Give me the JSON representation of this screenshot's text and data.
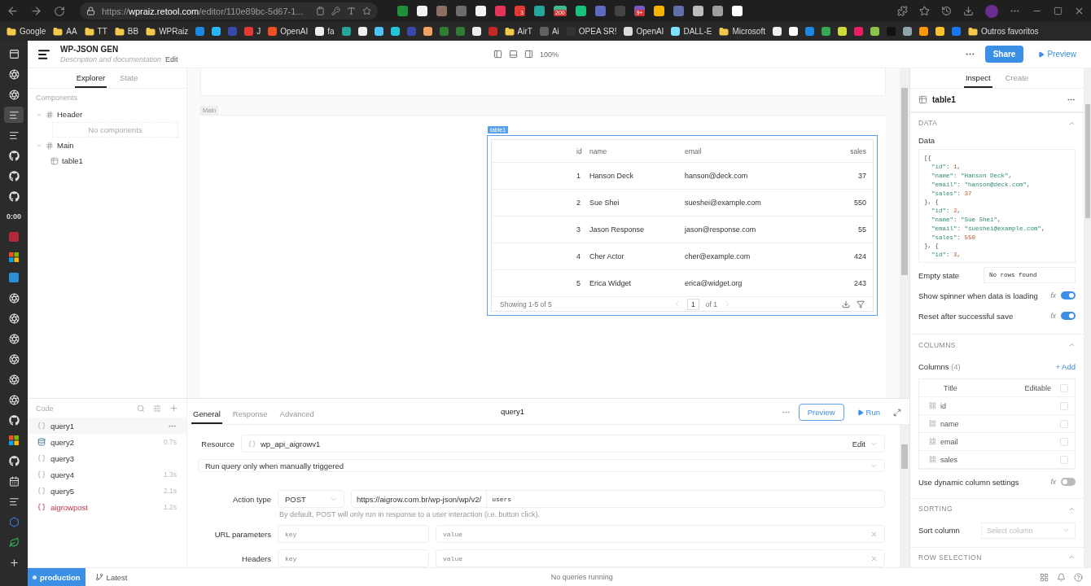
{
  "browser": {
    "url": "https://**wpraiz.retool.com**/editor/110e89bc-5d67-1...",
    "extensions": [
      {
        "color": "#1f8f3a"
      },
      {
        "color": "#f2f2f2"
      },
      {
        "color": "#8d6e63"
      },
      {
        "color": "#6d6d6d"
      },
      {
        "color": "#f2f2f2"
      },
      {
        "color": "#e8345a"
      },
      {
        "color": "#e53935",
        "badge": "3"
      },
      {
        "color": "#26a69a"
      },
      {
        "color": "#3dbb8f",
        "badge": "200"
      },
      {
        "color": "#17c27a"
      },
      {
        "color": "#5c6bc0"
      },
      {
        "color": "#444444"
      },
      {
        "color": "#7e57c2",
        "badge": "9+"
      },
      {
        "color": "#f4b400"
      },
      {
        "color": "#5f6fa8"
      },
      {
        "color": "#bdbdbd"
      },
      {
        "color": "#9e9e9e"
      },
      {
        "color": "#ffffff"
      }
    ]
  },
  "bookmarks": [
    {
      "kind": "folder",
      "label": "Google"
    },
    {
      "kind": "folder",
      "label": "AA"
    },
    {
      "kind": "folder",
      "label": "TT"
    },
    {
      "kind": "folder",
      "label": "BB"
    },
    {
      "kind": "folder",
      "label": "WPRaiz"
    },
    {
      "kind": "site",
      "color": "#1e88e5"
    },
    {
      "kind": "site",
      "color": "#29b6f6"
    },
    {
      "kind": "site",
      "color": "#3949ab"
    },
    {
      "kind": "site",
      "color": "#e53935",
      "label": "J"
    },
    {
      "kind": "site",
      "color": "#f25022",
      "label": "OpenAI"
    },
    {
      "kind": "site",
      "color": "#eeeeee",
      "label": "fa"
    },
    {
      "kind": "site",
      "color": "#26a69a"
    },
    {
      "kind": "site",
      "color": "#eeeeee"
    },
    {
      "kind": "site",
      "color": "#4fc3f7"
    },
    {
      "kind": "site",
      "color": "#26c6da"
    },
    {
      "kind": "site",
      "color": "#3949ab"
    },
    {
      "kind": "site",
      "color": "#f4a261"
    },
    {
      "kind": "site",
      "color": "#2e7d32"
    },
    {
      "kind": "site",
      "color": "#2e7d32"
    },
    {
      "kind": "site",
      "color": "#eeeeee"
    },
    {
      "kind": "site",
      "color": "#c62828"
    },
    {
      "kind": "folder",
      "label": "AirT"
    },
    {
      "kind": "site",
      "color": "#616161",
      "label": "Ai"
    },
    {
      "kind": "site",
      "color": "#333333",
      "label": "OPEA SR!"
    },
    {
      "kind": "site",
      "color": "#dddddd",
      "label": "OpenAI"
    },
    {
      "kind": "site",
      "color": "#7ee0ff",
      "label": "DALL-E"
    },
    {
      "kind": "folder",
      "label": "Microsoft"
    },
    {
      "kind": "site",
      "color": "#eeeeee"
    },
    {
      "kind": "site",
      "color": "#ffffff"
    },
    {
      "kind": "site",
      "color": "#1e88e5"
    },
    {
      "kind": "site",
      "color": "#34a853"
    },
    {
      "kind": "site",
      "color": "#cddc39"
    },
    {
      "kind": "site",
      "color": "#e91e63"
    },
    {
      "kind": "site",
      "color": "#8bc34a"
    },
    {
      "kind": "site",
      "color": "#111111"
    },
    {
      "kind": "site",
      "color": "#90a4ae"
    },
    {
      "kind": "site",
      "color": "#ff9800"
    },
    {
      "kind": "site",
      "color": "#fbc02d"
    },
    {
      "kind": "site",
      "color": "#1877f2"
    },
    {
      "kind": "folder",
      "label": "Outros favoritos"
    }
  ],
  "dock": [
    {
      "kind": "window",
      "selected": false
    },
    {
      "kind": "openai",
      "selected": false
    },
    {
      "kind": "openai",
      "selected": false
    },
    {
      "kind": "retool",
      "selected": true
    },
    {
      "kind": "retool",
      "selected": false
    },
    {
      "kind": "github",
      "selected": false
    },
    {
      "kind": "github",
      "selected": false
    },
    {
      "kind": "github",
      "selected": false
    },
    {
      "kind": "timer",
      "label": "0:00",
      "selected": false
    },
    {
      "kind": "red",
      "selected": false
    },
    {
      "kind": "microsoft",
      "selected": false
    },
    {
      "kind": "blue",
      "selected": false
    },
    {
      "kind": "openai",
      "selected": false
    },
    {
      "kind": "openai",
      "selected": false
    },
    {
      "kind": "openai",
      "selected": false
    },
    {
      "kind": "openai",
      "selected": false
    },
    {
      "kind": "openai",
      "selected": false
    },
    {
      "kind": "openai",
      "selected": false
    },
    {
      "kind": "github",
      "selected": false
    },
    {
      "kind": "microsoft",
      "selected": false
    },
    {
      "kind": "github",
      "selected": false
    },
    {
      "kind": "calendar",
      "selected": false
    },
    {
      "kind": "retool",
      "selected": false
    },
    {
      "kind": "hex",
      "selected": false
    },
    {
      "kind": "leaf",
      "selected": false
    },
    {
      "kind": "add",
      "selected": false
    }
  ],
  "header": {
    "app_name": "WP-JSON GEN",
    "description_placeholder": "Description and documentation",
    "edit": "Edit",
    "zoom": "100%",
    "share": "Share",
    "preview": "Preview"
  },
  "explorer": {
    "tabs": [
      {
        "label": "Explorer",
        "selected": true
      },
      {
        "label": "State",
        "selected": false
      }
    ],
    "section": "Components",
    "tree": [
      {
        "label": "Header",
        "kind": "frame",
        "expanded": true,
        "empty": "No components"
      },
      {
        "label": "Main",
        "kind": "frame",
        "expanded": true,
        "children": [
          {
            "label": "table1",
            "kind": "table"
          }
        ]
      }
    ]
  },
  "canvas": {
    "main_label": "Main",
    "table": {
      "tag": "table1",
      "columns": [
        {
          "label": "id"
        },
        {
          "label": "name"
        },
        {
          "label": "email"
        },
        {
          "label": "sales"
        }
      ],
      "rows": [
        [
          "1",
          "Hanson Deck",
          "hanson@deck.com",
          "37"
        ],
        [
          "2",
          "Sue Shei",
          "sueshei@example.com",
          "550"
        ],
        [
          "3",
          "Jason Response",
          "jason@response.com",
          "55"
        ],
        [
          "4",
          "Cher Actor",
          "cher@example.com",
          "424"
        ],
        [
          "5",
          "Erica Widget",
          "erica@widget.org",
          "243"
        ]
      ],
      "footer": "Showing 1-5 of 5",
      "page": "1",
      "page_total": "of 1"
    }
  },
  "code": {
    "title": "Code",
    "queries": [
      {
        "name": "query1",
        "kind": "rest",
        "hovered": true,
        "error": false
      },
      {
        "name": "query2",
        "kind": "postgres",
        "time": "0.7s",
        "hovered": false,
        "error": false
      },
      {
        "name": "query3",
        "kind": "rest",
        "hovered": false,
        "error": false
      },
      {
        "name": "query4",
        "kind": "rest",
        "time": "1.3s",
        "hovered": false,
        "error": false
      },
      {
        "name": "query5",
        "kind": "rest",
        "time": "2.1s",
        "hovered": false,
        "error": false
      },
      {
        "name": "aigrowpost",
        "kind": "rest",
        "time": "1.2s",
        "hovered": false,
        "error": true
      }
    ]
  },
  "editor": {
    "tabs": [
      {
        "label": "General",
        "selected": true
      },
      {
        "label": "Response",
        "selected": false
      },
      {
        "label": "Advanced",
        "selected": false
      }
    ],
    "title": "query1",
    "preview": "Preview",
    "run": "Run",
    "resource_label": "Resource",
    "resource": "wp_api_aigrowv1",
    "resource_edit": "Edit",
    "trigger": "Run query only when manually triggered",
    "action_label": "Action type",
    "method": "POST",
    "base_url": "https://aigrow.com.br/wp-json/wp/v2/",
    "path": "users",
    "hint": "By default, POST will only run in response to a user interaction (i.e. button click).",
    "params": [
      {
        "label": "URL parameters",
        "key_placeholder": "key",
        "value_placeholder": "value"
      },
      {
        "label": "Headers",
        "key_placeholder": "key",
        "value_placeholder": "value"
      }
    ]
  },
  "inspector": {
    "tabs": [
      {
        "label": "Inspect",
        "selected": true
      },
      {
        "label": "Create",
        "selected": false
      }
    ],
    "component": "table1",
    "data_section": {
      "title": "DATA",
      "data_label": "Data",
      "code": [
        "[{",
        "  \"id\": 1,",
        "  \"name\": \"Hanson Deck\",",
        "  \"email\": \"hanson@deck.com\",",
        "  \"sales\": 37",
        "}, {",
        "  \"id\": 2,",
        "  \"name\": \"Sue Shei\",",
        "  \"email\": \"sueshei@example.com\",",
        "  \"sales\": 550",
        "}, {",
        "  \"id\": 3,"
      ],
      "empty_label": "Empty state",
      "empty_value": "No rows found",
      "toggles": [
        {
          "label": "Show spinner when data is loading",
          "fx": "fx",
          "on": true
        },
        {
          "label": "Reset after successful save",
          "fx": "fx",
          "on": true
        }
      ]
    },
    "columns_section": {
      "title": "COLUMNS",
      "label": "Columns",
      "count": "(4)",
      "add": "+ Add",
      "header_title": "Title",
      "header_editable": "Editable",
      "header_checked": false,
      "items": [
        {
          "name": "id",
          "editable": false
        },
        {
          "name": "name",
          "editable": false
        },
        {
          "name": "email",
          "editable": false
        },
        {
          "name": "sales",
          "editable": false
        }
      ],
      "dynamic": {
        "label": "Use dynamic column settings",
        "fx": "fx",
        "on": false
      }
    },
    "sorting_section": {
      "title": "SORTING",
      "label": "Sort column",
      "placeholder": "Select column"
    },
    "row_selection_section": {
      "title": "ROW SELECTION"
    }
  },
  "status": {
    "env": "production",
    "version": "Latest",
    "message": "No queries running"
  }
}
